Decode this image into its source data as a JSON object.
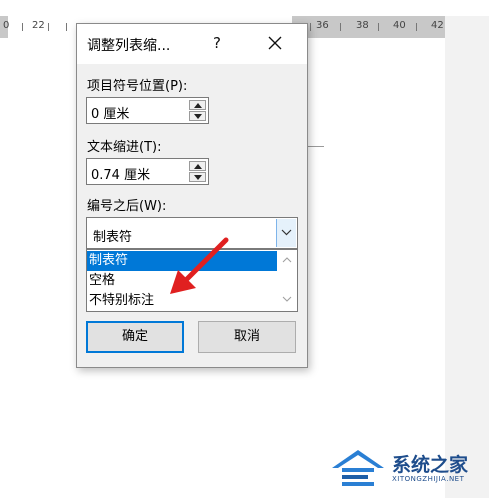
{
  "ruler": {
    "labels": [
      "0",
      "22",
      "36",
      "38",
      "40",
      "42"
    ]
  },
  "dialog": {
    "title": "调整列表缩...",
    "help_label": "?",
    "number_position_label": "项目符号位置(P):",
    "number_position_value": "0 厘米",
    "text_indent_label": "文本缩进(T):",
    "text_indent_value": "0.74 厘米",
    "follow_number_label": "编号之后(W):",
    "follow_number_value": "制表符",
    "options": [
      "制表符",
      "空格",
      "不特别标注"
    ],
    "ok_label": "确定",
    "cancel_label": "取消"
  },
  "colors": {
    "selection": "#0078d7",
    "annotation_arrow": "#e02020",
    "watermark": "#1e4d8c"
  },
  "watermark": {
    "text": "系统之家",
    "url": "XITONGZHIJIA.NET"
  }
}
